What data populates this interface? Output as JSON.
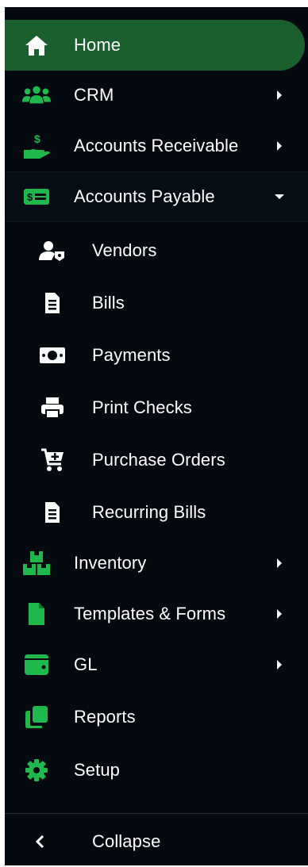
{
  "theme": {
    "sidebar_bg": "#050a11",
    "accent": "#1eb84d",
    "active_bg": "#1c5f2f",
    "text": "#ffffff"
  },
  "nav": {
    "items": [
      {
        "label": "Home",
        "icon": "home-icon",
        "active": true
      },
      {
        "label": "CRM",
        "icon": "users-icon",
        "has_submenu": true
      },
      {
        "label": "Accounts Receivable",
        "icon": "hand-money-icon",
        "has_submenu": true
      },
      {
        "label": "Accounts Payable",
        "icon": "money-bill-icon",
        "has_submenu": true,
        "expanded": true
      },
      {
        "label": "Inventory",
        "icon": "boxes-icon",
        "has_submenu": true
      },
      {
        "label": "Templates & Forms",
        "icon": "file-icon",
        "has_submenu": true
      },
      {
        "label": "GL",
        "icon": "wallet-icon",
        "has_submenu": true
      },
      {
        "label": "Reports",
        "icon": "copy-icon"
      },
      {
        "label": "Setup",
        "icon": "gear-icon"
      }
    ],
    "ap_subitems": [
      {
        "label": "Vendors",
        "icon": "user-tag-icon"
      },
      {
        "label": "Bills",
        "icon": "document-icon"
      },
      {
        "label": "Payments",
        "icon": "cash-icon"
      },
      {
        "label": "Print Checks",
        "icon": "printer-icon"
      },
      {
        "label": "Purchase Orders",
        "icon": "cart-icon"
      },
      {
        "label": "Recurring Bills",
        "icon": "document-icon"
      }
    ]
  },
  "footer": {
    "collapse_label": "Collapse",
    "collapse_icon": "chevron-left-icon"
  }
}
